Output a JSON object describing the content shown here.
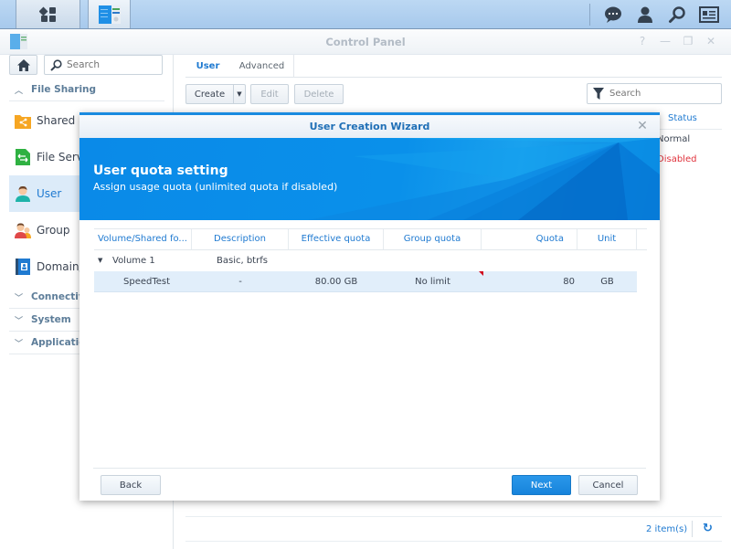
{
  "taskbar": {
    "main_menu_icon": "grid-icon",
    "app_icon": "control-panel-icon",
    "right_icons": [
      "chat-icon",
      "user-icon",
      "search-icon",
      "widget-icon"
    ]
  },
  "window": {
    "title": "Control Panel",
    "controls": [
      "help-icon",
      "minimize-icon",
      "restore-icon",
      "close-icon"
    ]
  },
  "sidebar": {
    "search_placeholder": "Search",
    "sections": [
      {
        "label": "File Sharing",
        "expanded": true
      },
      {
        "label": "Connectivity",
        "expanded": false
      },
      {
        "label": "System",
        "expanded": false
      },
      {
        "label": "Applications",
        "expanded": false
      }
    ],
    "items": [
      {
        "label": "Shared Folder",
        "icon": "shared-folder-icon",
        "active": false
      },
      {
        "label": "File Services",
        "icon": "file-services-icon",
        "active": false
      },
      {
        "label": "User",
        "icon": "user-icon",
        "active": true
      },
      {
        "label": "Group",
        "icon": "group-icon",
        "active": false
      },
      {
        "label": "Domain/LDAP",
        "icon": "domain-icon",
        "active": false
      }
    ]
  },
  "main": {
    "tabs": [
      {
        "label": "User",
        "active": true
      },
      {
        "label": "Advanced",
        "active": false
      }
    ],
    "toolbar": {
      "create": "Create",
      "edit": "Edit",
      "delete": "Delete",
      "filter_placeholder": "Search"
    },
    "grid": {
      "status_header": "Status",
      "status_values": [
        {
          "text": "Normal",
          "color": "#3b4452"
        },
        {
          "text": "Disabled",
          "color": "#e0323c"
        }
      ]
    },
    "footer": {
      "item_count": "2 item(s)"
    }
  },
  "wizard": {
    "title": "User Creation Wizard",
    "step_title": "User quota setting",
    "step_subtitle": "Assign usage quota (unlimited quota if disabled)",
    "columns": [
      "Volume/Shared fo...",
      "Description",
      "Effective quota",
      "Group quota",
      "Quota",
      "Unit"
    ],
    "volume_row": {
      "name": "Volume 1",
      "description": "Basic, btrfs"
    },
    "rows": [
      {
        "name": "SpeedTest",
        "description": "-",
        "effective_quota": "80.00 GB",
        "group_quota": "No limit",
        "quota": "80",
        "unit": "GB"
      }
    ],
    "buttons": {
      "back": "Back",
      "next": "Next",
      "cancel": "Cancel"
    },
    "accent_color": "#1a8be0"
  }
}
